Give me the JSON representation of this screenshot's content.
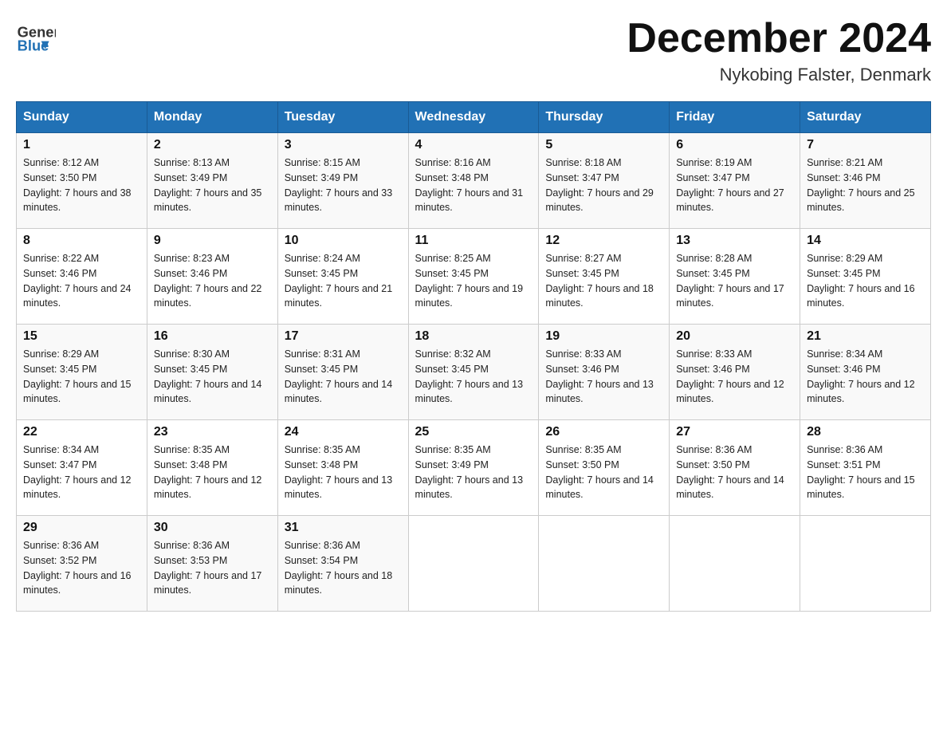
{
  "header": {
    "logo_line1": "General",
    "logo_line2": "Blue",
    "month_title": "December 2024",
    "location": "Nykobing Falster, Denmark"
  },
  "weekdays": [
    "Sunday",
    "Monday",
    "Tuesday",
    "Wednesday",
    "Thursday",
    "Friday",
    "Saturday"
  ],
  "weeks": [
    [
      {
        "day": "1",
        "sunrise": "8:12 AM",
        "sunset": "3:50 PM",
        "daylight": "7 hours and 38 minutes."
      },
      {
        "day": "2",
        "sunrise": "8:13 AM",
        "sunset": "3:49 PM",
        "daylight": "7 hours and 35 minutes."
      },
      {
        "day": "3",
        "sunrise": "8:15 AM",
        "sunset": "3:49 PM",
        "daylight": "7 hours and 33 minutes."
      },
      {
        "day": "4",
        "sunrise": "8:16 AM",
        "sunset": "3:48 PM",
        "daylight": "7 hours and 31 minutes."
      },
      {
        "day": "5",
        "sunrise": "8:18 AM",
        "sunset": "3:47 PM",
        "daylight": "7 hours and 29 minutes."
      },
      {
        "day": "6",
        "sunrise": "8:19 AM",
        "sunset": "3:47 PM",
        "daylight": "7 hours and 27 minutes."
      },
      {
        "day": "7",
        "sunrise": "8:21 AM",
        "sunset": "3:46 PM",
        "daylight": "7 hours and 25 minutes."
      }
    ],
    [
      {
        "day": "8",
        "sunrise": "8:22 AM",
        "sunset": "3:46 PM",
        "daylight": "7 hours and 24 minutes."
      },
      {
        "day": "9",
        "sunrise": "8:23 AM",
        "sunset": "3:46 PM",
        "daylight": "7 hours and 22 minutes."
      },
      {
        "day": "10",
        "sunrise": "8:24 AM",
        "sunset": "3:45 PM",
        "daylight": "7 hours and 21 minutes."
      },
      {
        "day": "11",
        "sunrise": "8:25 AM",
        "sunset": "3:45 PM",
        "daylight": "7 hours and 19 minutes."
      },
      {
        "day": "12",
        "sunrise": "8:27 AM",
        "sunset": "3:45 PM",
        "daylight": "7 hours and 18 minutes."
      },
      {
        "day": "13",
        "sunrise": "8:28 AM",
        "sunset": "3:45 PM",
        "daylight": "7 hours and 17 minutes."
      },
      {
        "day": "14",
        "sunrise": "8:29 AM",
        "sunset": "3:45 PM",
        "daylight": "7 hours and 16 minutes."
      }
    ],
    [
      {
        "day": "15",
        "sunrise": "8:29 AM",
        "sunset": "3:45 PM",
        "daylight": "7 hours and 15 minutes."
      },
      {
        "day": "16",
        "sunrise": "8:30 AM",
        "sunset": "3:45 PM",
        "daylight": "7 hours and 14 minutes."
      },
      {
        "day": "17",
        "sunrise": "8:31 AM",
        "sunset": "3:45 PM",
        "daylight": "7 hours and 14 minutes."
      },
      {
        "day": "18",
        "sunrise": "8:32 AM",
        "sunset": "3:45 PM",
        "daylight": "7 hours and 13 minutes."
      },
      {
        "day": "19",
        "sunrise": "8:33 AM",
        "sunset": "3:46 PM",
        "daylight": "7 hours and 13 minutes."
      },
      {
        "day": "20",
        "sunrise": "8:33 AM",
        "sunset": "3:46 PM",
        "daylight": "7 hours and 12 minutes."
      },
      {
        "day": "21",
        "sunrise": "8:34 AM",
        "sunset": "3:46 PM",
        "daylight": "7 hours and 12 minutes."
      }
    ],
    [
      {
        "day": "22",
        "sunrise": "8:34 AM",
        "sunset": "3:47 PM",
        "daylight": "7 hours and 12 minutes."
      },
      {
        "day": "23",
        "sunrise": "8:35 AM",
        "sunset": "3:48 PM",
        "daylight": "7 hours and 12 minutes."
      },
      {
        "day": "24",
        "sunrise": "8:35 AM",
        "sunset": "3:48 PM",
        "daylight": "7 hours and 13 minutes."
      },
      {
        "day": "25",
        "sunrise": "8:35 AM",
        "sunset": "3:49 PM",
        "daylight": "7 hours and 13 minutes."
      },
      {
        "day": "26",
        "sunrise": "8:35 AM",
        "sunset": "3:50 PM",
        "daylight": "7 hours and 14 minutes."
      },
      {
        "day": "27",
        "sunrise": "8:36 AM",
        "sunset": "3:50 PM",
        "daylight": "7 hours and 14 minutes."
      },
      {
        "day": "28",
        "sunrise": "8:36 AM",
        "sunset": "3:51 PM",
        "daylight": "7 hours and 15 minutes."
      }
    ],
    [
      {
        "day": "29",
        "sunrise": "8:36 AM",
        "sunset": "3:52 PM",
        "daylight": "7 hours and 16 minutes."
      },
      {
        "day": "30",
        "sunrise": "8:36 AM",
        "sunset": "3:53 PM",
        "daylight": "7 hours and 17 minutes."
      },
      {
        "day": "31",
        "sunrise": "8:36 AM",
        "sunset": "3:54 PM",
        "daylight": "7 hours and 18 minutes."
      },
      null,
      null,
      null,
      null
    ]
  ],
  "labels": {
    "sunrise_prefix": "Sunrise: ",
    "sunset_prefix": "Sunset: ",
    "daylight_prefix": "Daylight: "
  }
}
